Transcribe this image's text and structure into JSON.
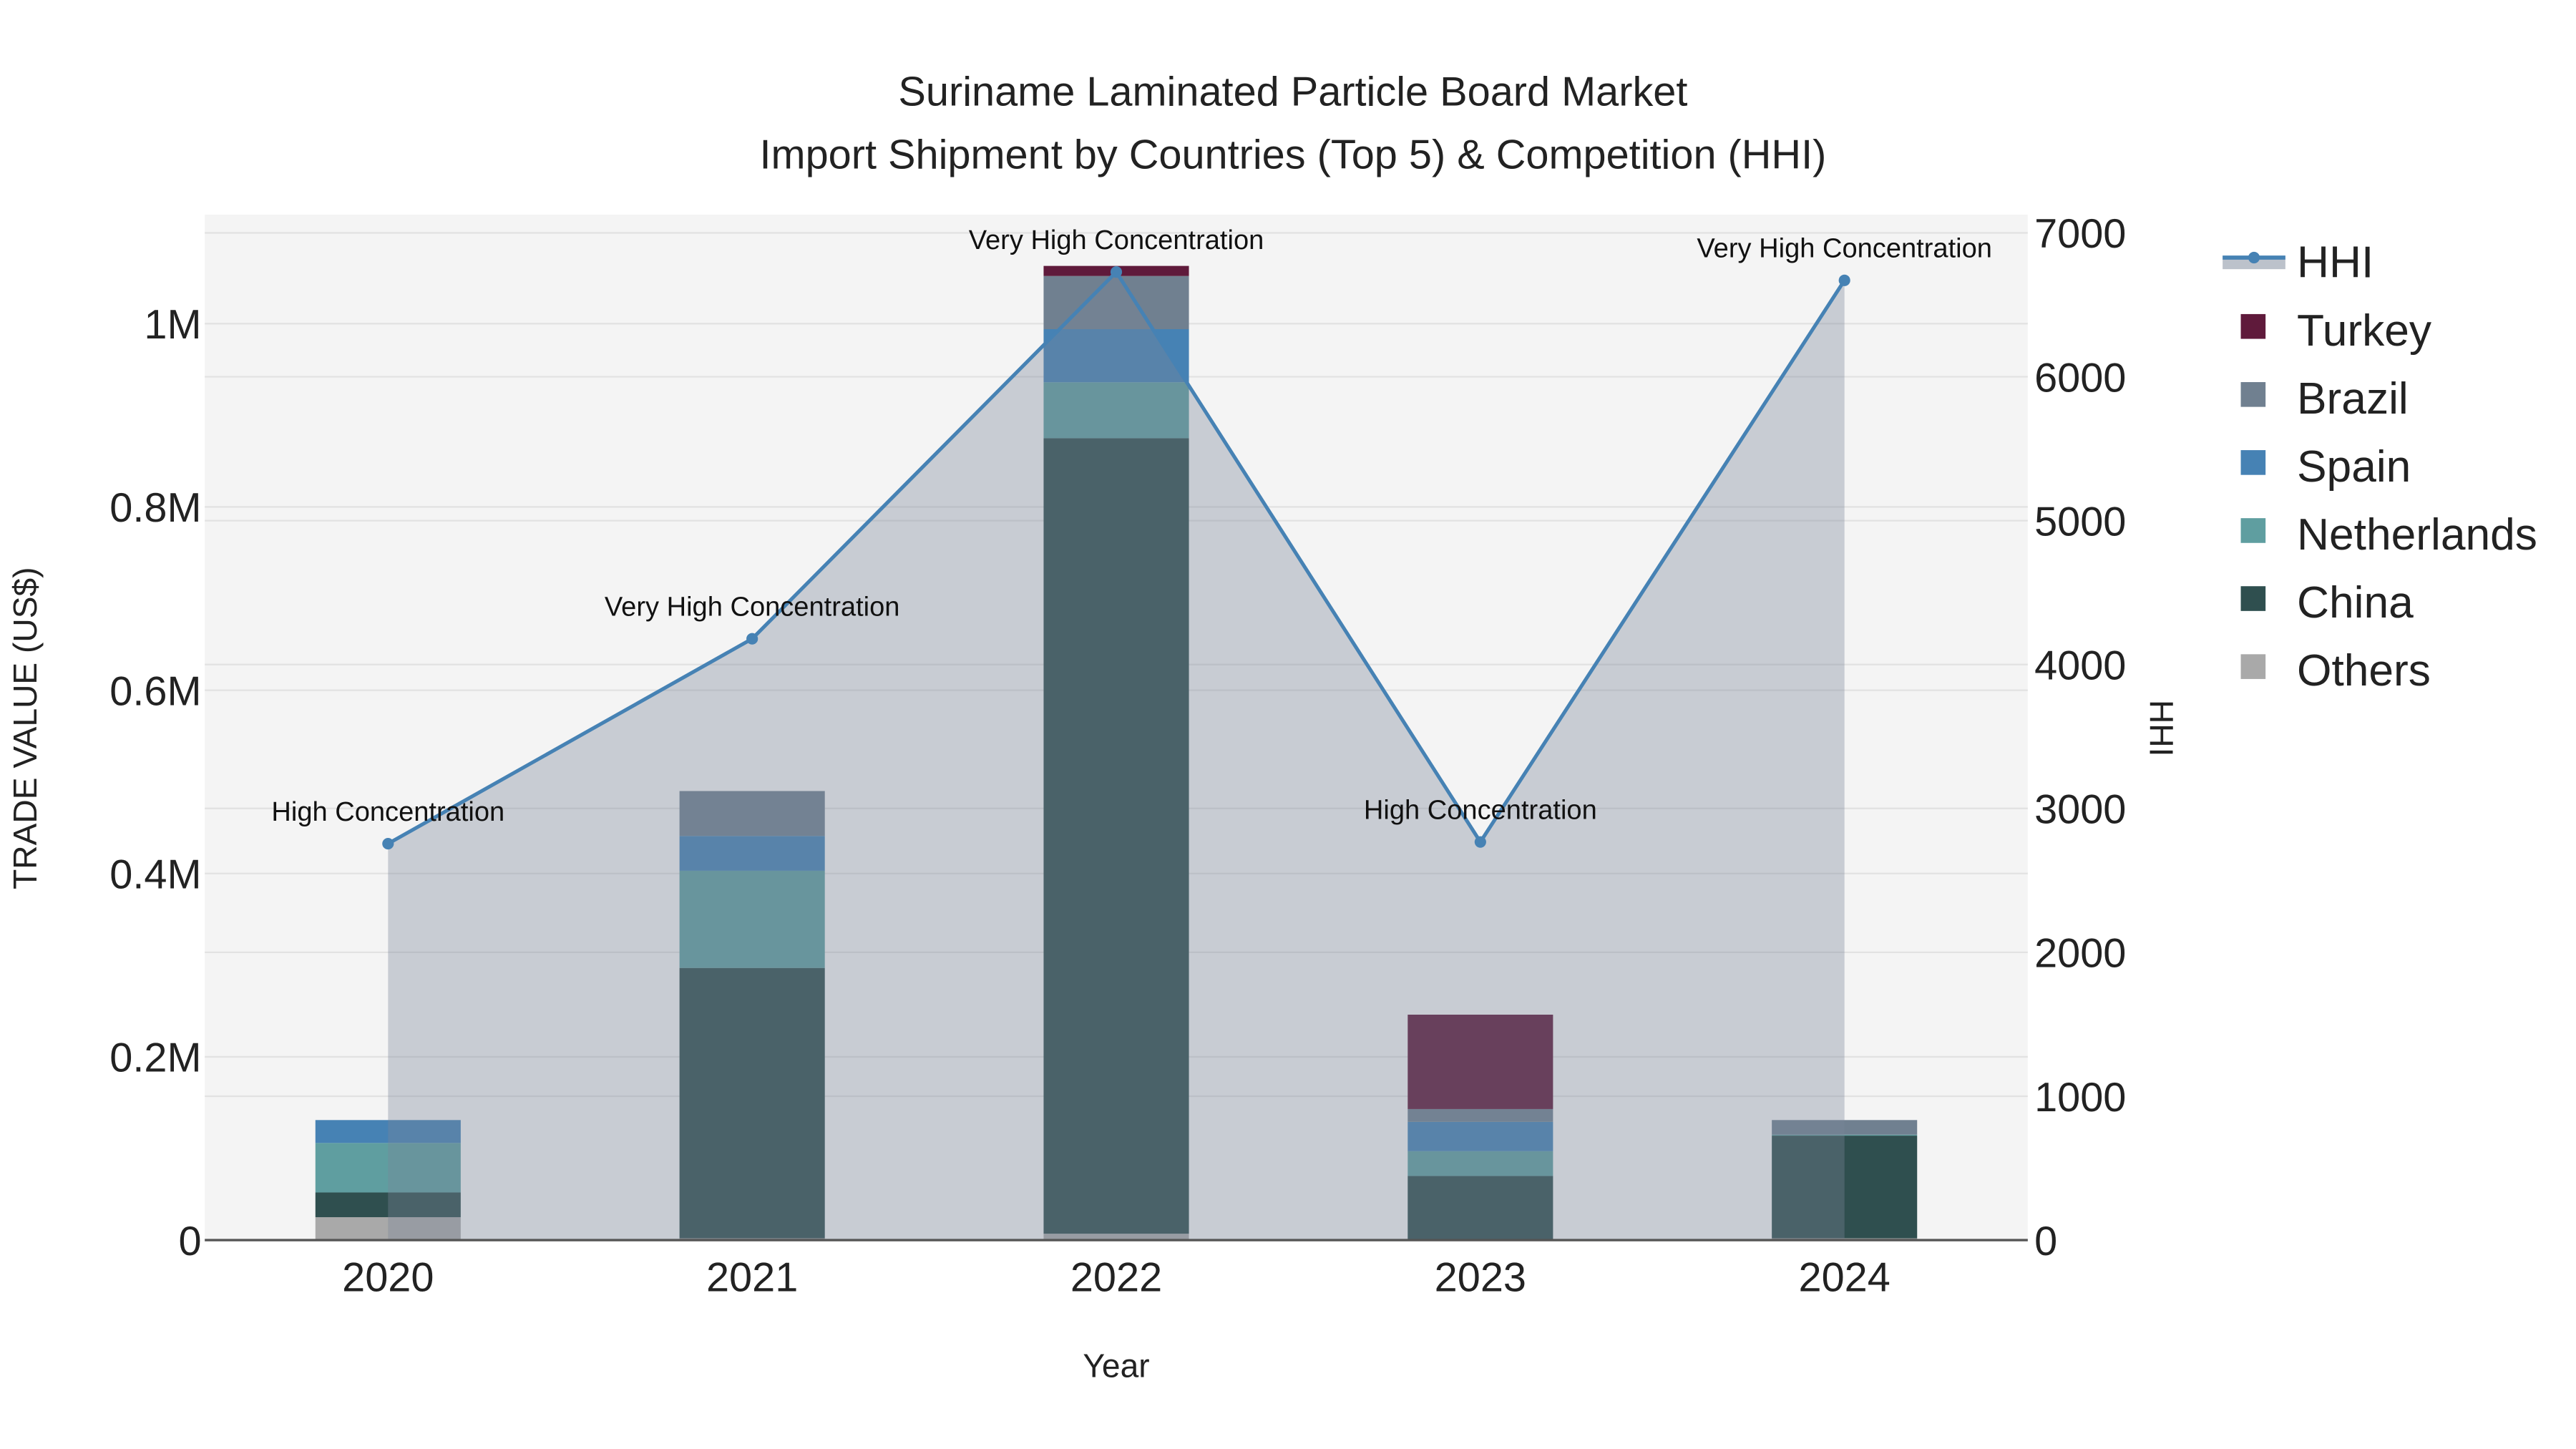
{
  "chart_data": {
    "type": "bar",
    "title": [
      "Suriname Laminated Particle Board Market",
      "Import Shipment by Countries (Top 5) & Competition (HHI)"
    ],
    "xlabel": "Year",
    "ylabel": "TRADE VALUE (US$)",
    "y2label": "HHI",
    "categories": [
      "2020",
      "2021",
      "2022",
      "2023",
      "2024"
    ],
    "ylim": [
      0,
      1100000
    ],
    "y2lim": [
      0,
      7100
    ],
    "yticks": [
      {
        "v": 0,
        "label": "0"
      },
      {
        "v": 200000,
        "label": "0.2M"
      },
      {
        "v": 400000,
        "label": "0.4M"
      },
      {
        "v": 600000,
        "label": "0.6M"
      },
      {
        "v": 800000,
        "label": "0.8M"
      },
      {
        "v": 1000000,
        "label": "1M"
      }
    ],
    "y2ticks": [
      {
        "v": 0,
        "label": "0"
      },
      {
        "v": 1000,
        "label": "1000"
      },
      {
        "v": 2000,
        "label": "2000"
      },
      {
        "v": 3000,
        "label": "3000"
      },
      {
        "v": 4000,
        "label": "4000"
      },
      {
        "v": 5000,
        "label": "5000"
      },
      {
        "v": 6000,
        "label": "6000"
      },
      {
        "v": 7000,
        "label": "7000"
      }
    ],
    "series": [
      {
        "name": "Others",
        "color": "#a9a9a9",
        "values": [
          25000,
          2000,
          7000,
          0,
          2000
        ]
      },
      {
        "name": "China",
        "color": "#2f4f4f",
        "values": [
          27000,
          295000,
          868000,
          70000,
          112000
        ]
      },
      {
        "name": "Netherlands",
        "color": "#5f9ea0",
        "values": [
          54000,
          106000,
          61000,
          27000,
          1000
        ]
      },
      {
        "name": "Spain",
        "color": "#4682b4",
        "values": [
          25000,
          38000,
          58000,
          32000,
          0
        ]
      },
      {
        "name": "Brazil",
        "color": "#708090",
        "values": [
          0,
          49000,
          58000,
          14000,
          16000
        ]
      },
      {
        "name": "Turkey",
        "color": "#5f1a3b",
        "values": [
          0,
          0,
          11000,
          103000,
          0
        ]
      }
    ],
    "hhi": {
      "name": "HHI",
      "color": "#4682b4",
      "values": [
        2755,
        4179,
        6728,
        2767,
        6670
      ],
      "annotations": [
        "High Concentration",
        "Very High Concentration",
        "Very High Concentration",
        "High Concentration",
        "Very High Concentration"
      ]
    },
    "legend": [
      "HHI",
      "Turkey",
      "Brazil",
      "Spain",
      "Netherlands",
      "China",
      "Others"
    ],
    "legend_position": "right",
    "grid": true
  }
}
